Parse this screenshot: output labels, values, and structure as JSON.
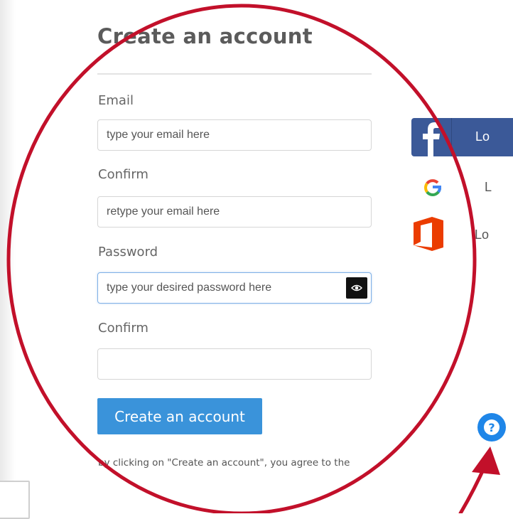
{
  "form": {
    "title": "Create an account",
    "email_label": "Email",
    "email_placeholder": "type your email here",
    "email_confirm_label": "Confirm",
    "email_confirm_placeholder": "retype your email here",
    "password_label": "Password",
    "password_placeholder": "type your desired password here",
    "password_confirm_label": "Confirm",
    "password_confirm_placeholder": "",
    "submit_label": "Create an account",
    "agreement_text": "by clicking on \"Create an account\", you agree to the"
  },
  "social_login": {
    "facebook_label": "Lo",
    "google_label": "L",
    "office_label": "Lo"
  },
  "icons": {
    "password_toggle": "eye-icon",
    "facebook": "facebook-icon",
    "google": "google-icon",
    "office": "office-icon",
    "help": "help-icon"
  },
  "colors": {
    "primary_button": "#3a93da",
    "facebook": "#3b5998",
    "office": "#eb3c00",
    "help_button": "#1f86e8",
    "annotation": "#c2102a"
  }
}
